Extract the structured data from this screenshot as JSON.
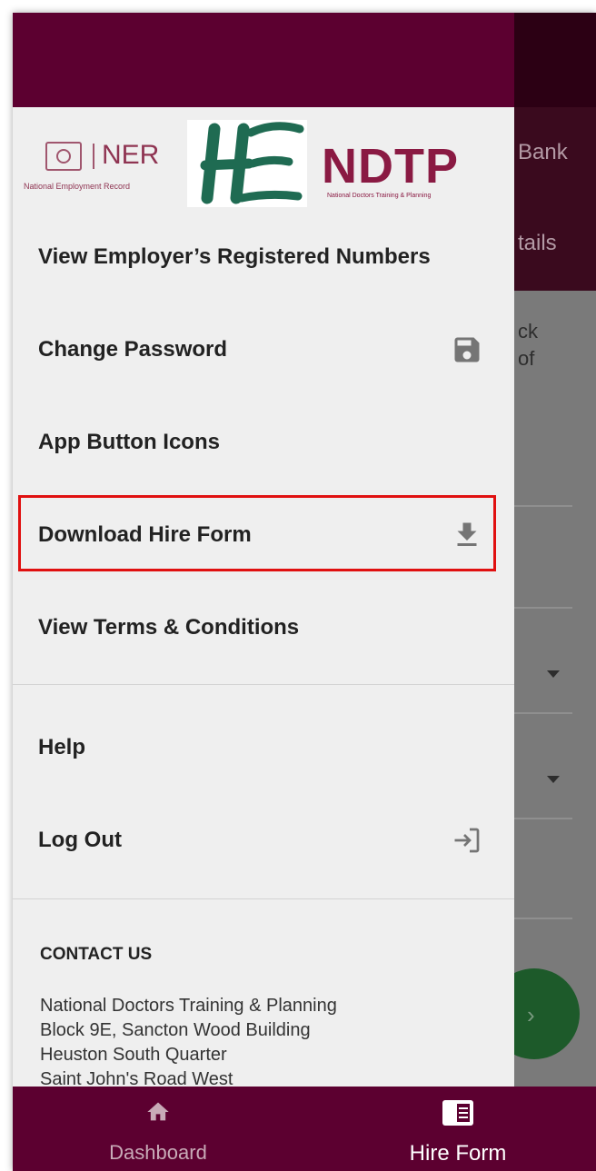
{
  "background": {
    "tab_row1_text": "Bank",
    "tab_row2_text": "tails",
    "content_frag_1": "ck",
    "content_frag_2": "of",
    "fab_icon": "chevron-right-icon"
  },
  "drawer": {
    "logos": {
      "ner_text": "NER",
      "ner_sub": "National Employment Record",
      "hse_logo": "HSE",
      "ndtp_text": "NDTP",
      "ndtp_sub": "National Doctors Training & Planning"
    },
    "menu": [
      {
        "label": "View Employer’s Registered Numbers",
        "icon": ""
      },
      {
        "label": "Change Password",
        "icon": "save-icon"
      },
      {
        "label": "App Button Icons",
        "icon": ""
      },
      {
        "label": "Download Hire Form",
        "icon": "download-icon"
      },
      {
        "label": "View Terms & Conditions",
        "icon": ""
      },
      {
        "label": "Help",
        "icon": ""
      },
      {
        "label": "Log Out",
        "icon": "logout-icon"
      }
    ],
    "contact": {
      "title": "CONTACT US",
      "lines": [
        "National Doctors Training & Planning",
        "Block 9E, Sancton Wood Building",
        "Heuston South Quarter",
        "Saint John's Road West"
      ]
    }
  },
  "bottom_nav": {
    "items": [
      {
        "label": "Dashboard",
        "icon": "home-icon",
        "active": false
      },
      {
        "label": "Hire Form",
        "icon": "form-icon",
        "active": true
      }
    ]
  },
  "colors": {
    "brand": "#5c0030",
    "highlight": "#e01010"
  }
}
